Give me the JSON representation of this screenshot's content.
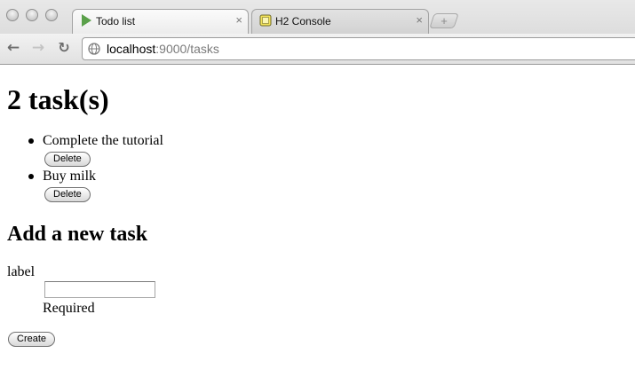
{
  "browser": {
    "tabs": [
      {
        "title": "Todo list",
        "favicon": "play-triangle-icon",
        "active": true
      },
      {
        "title": "H2 Console",
        "favicon": "h2-database-icon",
        "active": false
      }
    ],
    "close_glyph": "×",
    "new_tab_glyph": "+",
    "url_host": "localhost",
    "url_rest": ":9000/tasks"
  },
  "page": {
    "heading": "2 task(s)",
    "tasks": [
      {
        "label": "Complete the tutorial",
        "delete_label": "Delete"
      },
      {
        "label": "Buy milk",
        "delete_label": "Delete"
      }
    ],
    "form": {
      "heading": "Add a new task",
      "field_label": "label",
      "field_value": "",
      "help_text": "Required",
      "submit_label": "Create"
    }
  },
  "colors": {
    "tab_favicon_green": "#5aa04a",
    "h2_icon_yellow": "#f3e35a"
  }
}
